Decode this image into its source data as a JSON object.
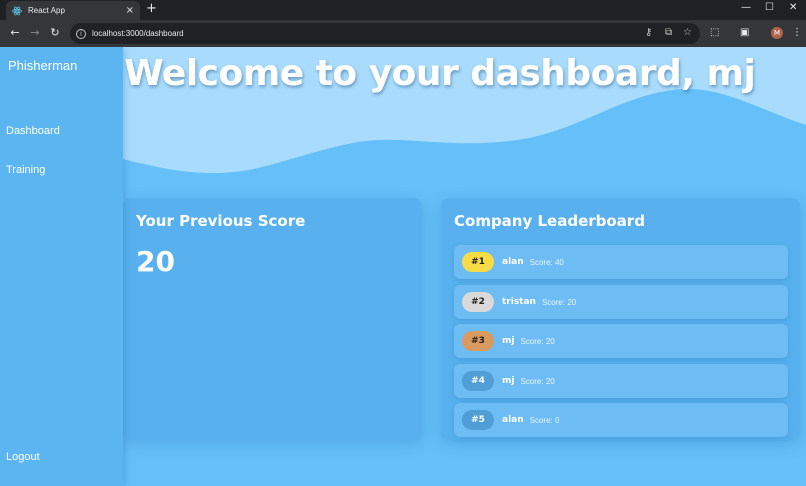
{
  "browser": {
    "tab_title": "React App",
    "tab_close": "×",
    "new_tab": "+",
    "url": "localhost:3000/dashboard",
    "avatar_initial": "M",
    "window_controls": {
      "minimize": "—",
      "maximize": "☐",
      "close": "✕"
    }
  },
  "sidebar": {
    "brand": "Phisherman",
    "links": [
      {
        "label": "Dashboard"
      },
      {
        "label": "Training"
      }
    ],
    "logout": "Logout"
  },
  "hero": {
    "title": "Welcome to your dashboard, mj"
  },
  "previous_score": {
    "title": "Your Previous Score",
    "value": "20"
  },
  "leaderboard": {
    "title": "Company Leaderboard",
    "entries": [
      {
        "rank": "#1",
        "name": "alan",
        "score": "Score: 40",
        "badge_color": "#f7dc46",
        "badge_text": "#222222"
      },
      {
        "rank": "#2",
        "name": "tristan",
        "score": "Score: 20",
        "badge_color": "#d9d9d9",
        "badge_text": "#222222"
      },
      {
        "rank": "#3",
        "name": "mj",
        "score": "Score: 20",
        "badge_color": "#d99a5f",
        "badge_text": "#222222"
      },
      {
        "rank": "#4",
        "name": "mj",
        "score": "Score: 20",
        "badge_color": "#4f9fd6",
        "badge_text": "#ffffff"
      },
      {
        "rank": "#5",
        "name": "alan",
        "score": "Score: 0",
        "badge_color": "#4f9fd6",
        "badge_text": "#ffffff"
      }
    ]
  },
  "colors": {
    "page_bg": "#65bff8",
    "sidebar_bg": "#5ab5f0",
    "card_bg": "#58b1ee",
    "wave_light": "#a9dcfc"
  }
}
